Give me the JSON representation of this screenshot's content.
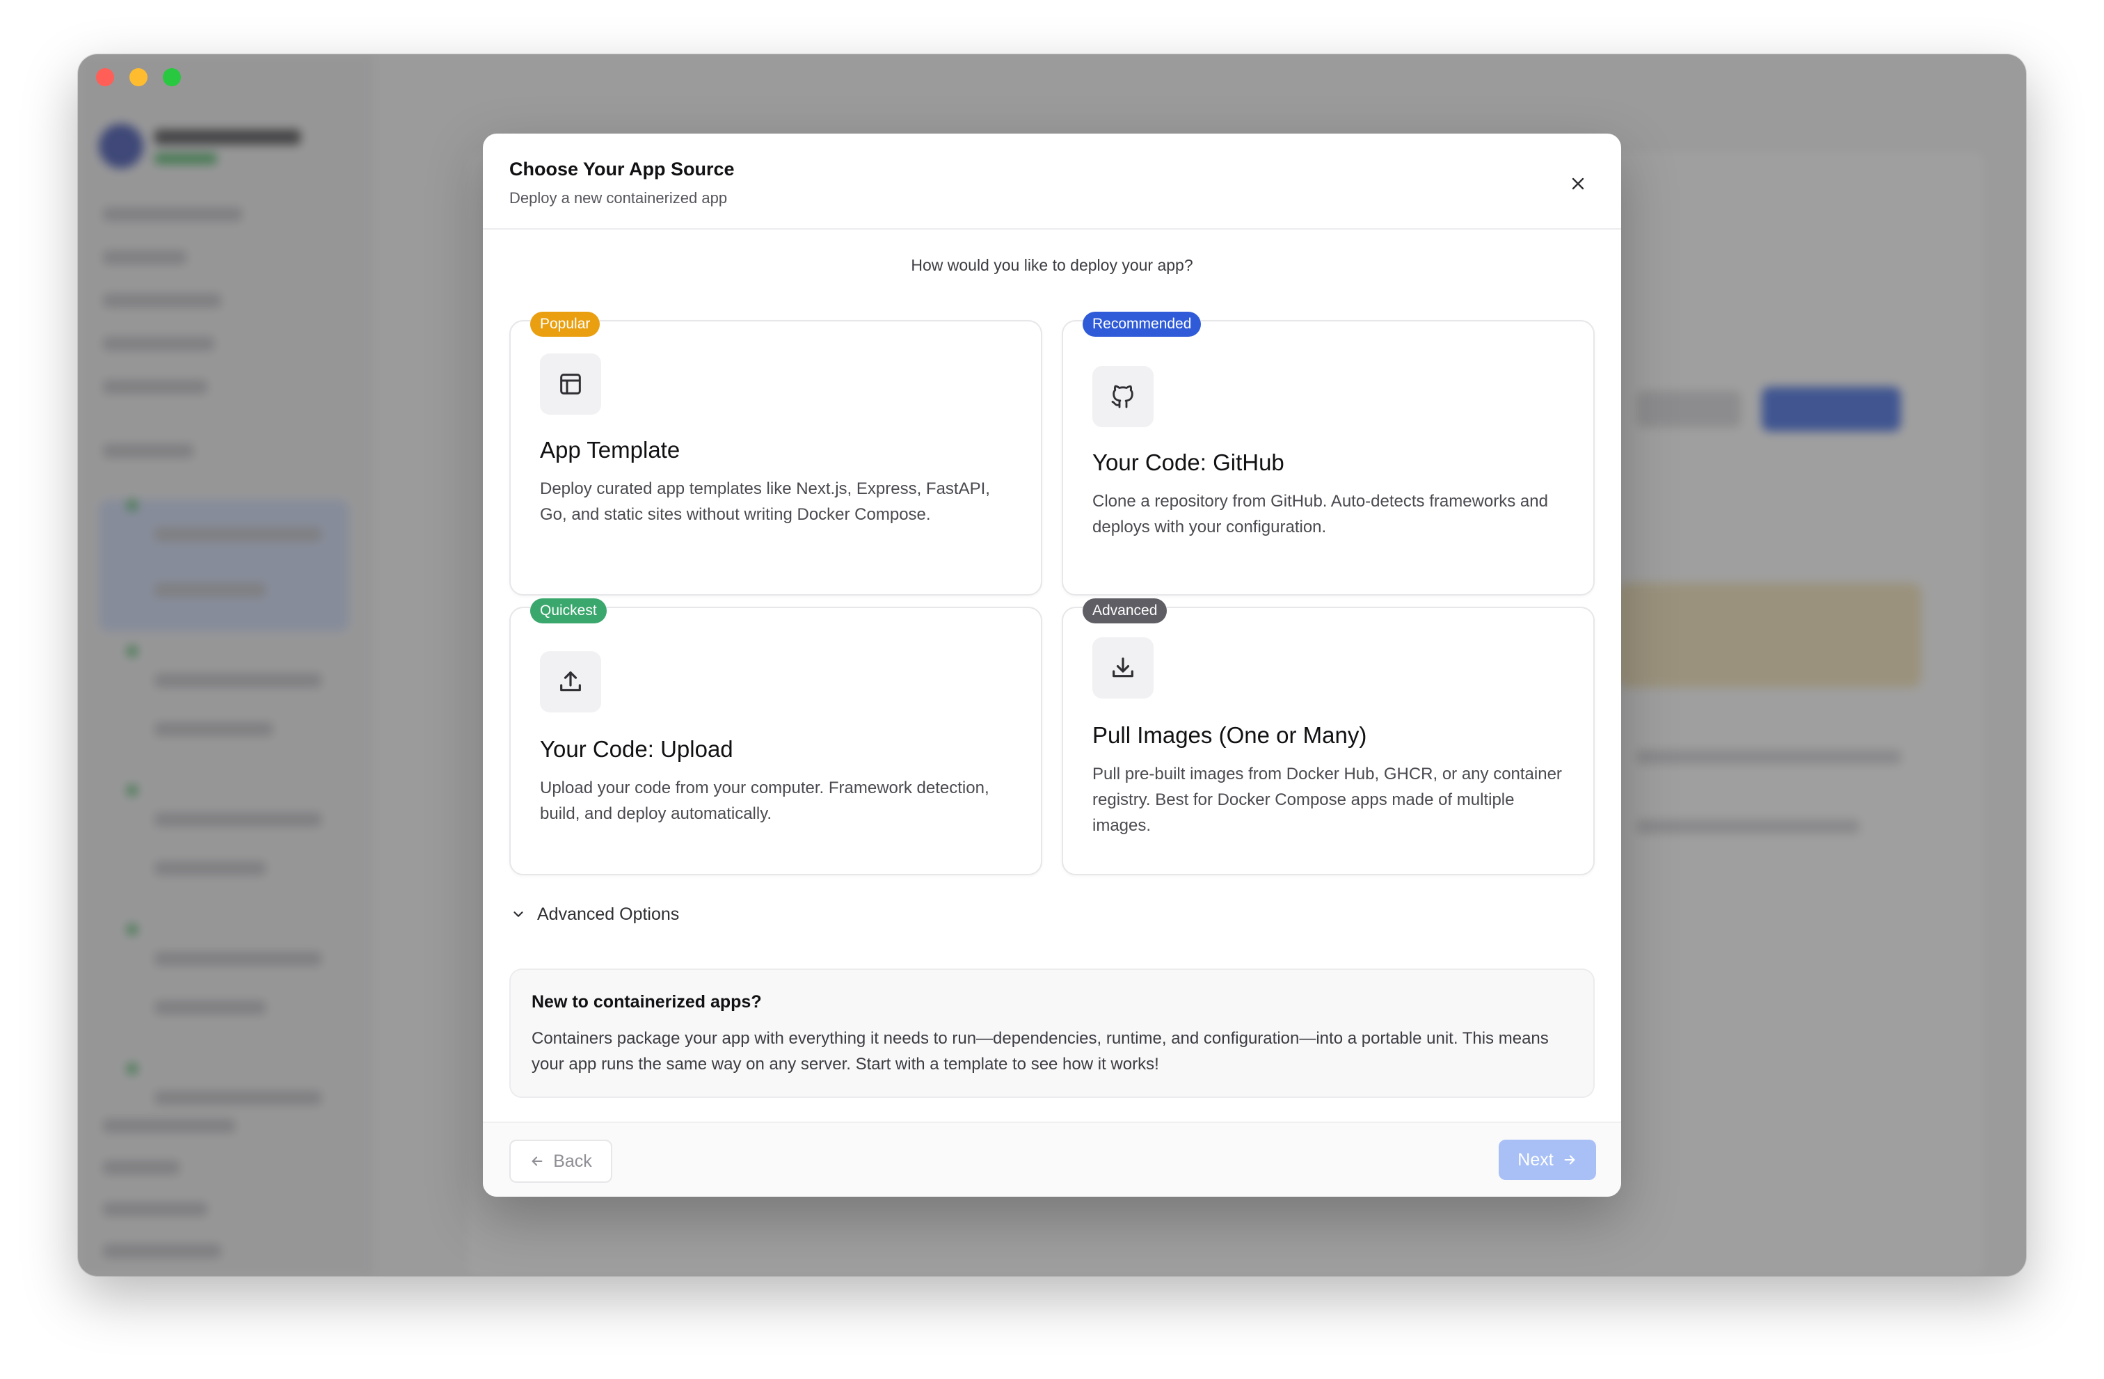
{
  "modal": {
    "title": "Choose Your App Source",
    "subtitle": "Deploy a new containerized app",
    "question": "How would you like to deploy your app?"
  },
  "options": [
    {
      "badge": "Popular",
      "badge_color": "#e99f0f",
      "icon": "layout-template-icon",
      "title": "App Template",
      "description": "Deploy curated app templates like Next.js, Express, FastAPI, Go, and static sites without writing Docker Compose."
    },
    {
      "badge": "Recommended",
      "badge_color": "#2f5bd8",
      "icon": "github-icon",
      "title": "Your Code: GitHub",
      "description": "Clone a repository from GitHub. Auto-detects frameworks and deploys with your configuration."
    },
    {
      "badge": "Quickest",
      "badge_color": "#3aa76d",
      "icon": "upload-icon",
      "title": "Your Code: Upload",
      "description": "Upload your code from your computer. Framework detection, build, and deploy automatically."
    },
    {
      "badge": "Advanced",
      "badge_color": "#5e5e64",
      "icon": "download-icon",
      "title": "Pull Images (One or Many)",
      "description": "Pull pre-built images from Docker Hub, GHCR, or any container registry. Best for Docker Compose apps made of multiple images."
    }
  ],
  "advanced_options": {
    "label": "Advanced Options",
    "icon": "chevron-down-icon"
  },
  "info": {
    "title": "New to containerized apps?",
    "text": "Containers package your app with everything it needs to run—dependencies, runtime, and configuration—into a portable unit. This means your app runs the same way on any server. Start with a template to see how it works!"
  },
  "footer": {
    "back_label": "Back",
    "next_label": "Next"
  },
  "colors": {
    "next_button_disabled": "#a9c0f6",
    "overlay": "rgba(80,80,80,0.55)"
  }
}
